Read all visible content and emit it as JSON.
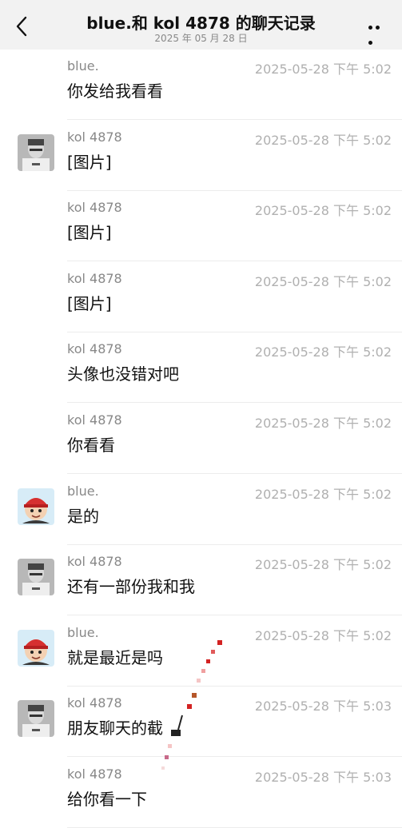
{
  "header": {
    "back_icon": "chevron-left-icon",
    "title": "blue.和 kol 4878 的聊天记录",
    "date": "2025 年 05 月 28 日",
    "more_icon": "more-horizontal-icon"
  },
  "messages": [
    {
      "sender": "blue.",
      "time": "2025-05-28 下午 5:02",
      "text": "你发给我看看",
      "avatar": "none"
    },
    {
      "sender": "kol 4878",
      "time": "2025-05-28 下午 5:02",
      "text": "[图片]",
      "avatar": "kol-avatar"
    },
    {
      "sender": "kol 4878",
      "time": "2025-05-28 下午 5:02",
      "text": "[图片]",
      "avatar": "none"
    },
    {
      "sender": "kol 4878",
      "time": "2025-05-28 下午 5:02",
      "text": "[图片]",
      "avatar": "none"
    },
    {
      "sender": "kol 4878",
      "time": "2025-05-28 下午 5:02",
      "text": "头像也没错对吧",
      "avatar": "none"
    },
    {
      "sender": "kol 4878",
      "time": "2025-05-28 下午 5:02",
      "text": "你看看",
      "avatar": "none"
    },
    {
      "sender": "blue.",
      "time": "2025-05-28 下午 5:02",
      "text": "是的",
      "avatar": "blue-avatar"
    },
    {
      "sender": "kol 4878",
      "time": "2025-05-28 下午 5:02",
      "text": "还有一部份我和我",
      "avatar": "kol-avatar"
    },
    {
      "sender": "blue.",
      "time": "2025-05-28 下午 5:02",
      "text": "就是最近是吗",
      "avatar": "blue-avatar"
    },
    {
      "sender": "kol 4878",
      "time": "2025-05-28 下午 5:03",
      "text": "朋友聊天的截",
      "avatar": "kol-avatar"
    },
    {
      "sender": "kol 4878",
      "time": "2025-05-28 下午 5:03",
      "text": "给你看一下",
      "avatar": "none"
    }
  ]
}
